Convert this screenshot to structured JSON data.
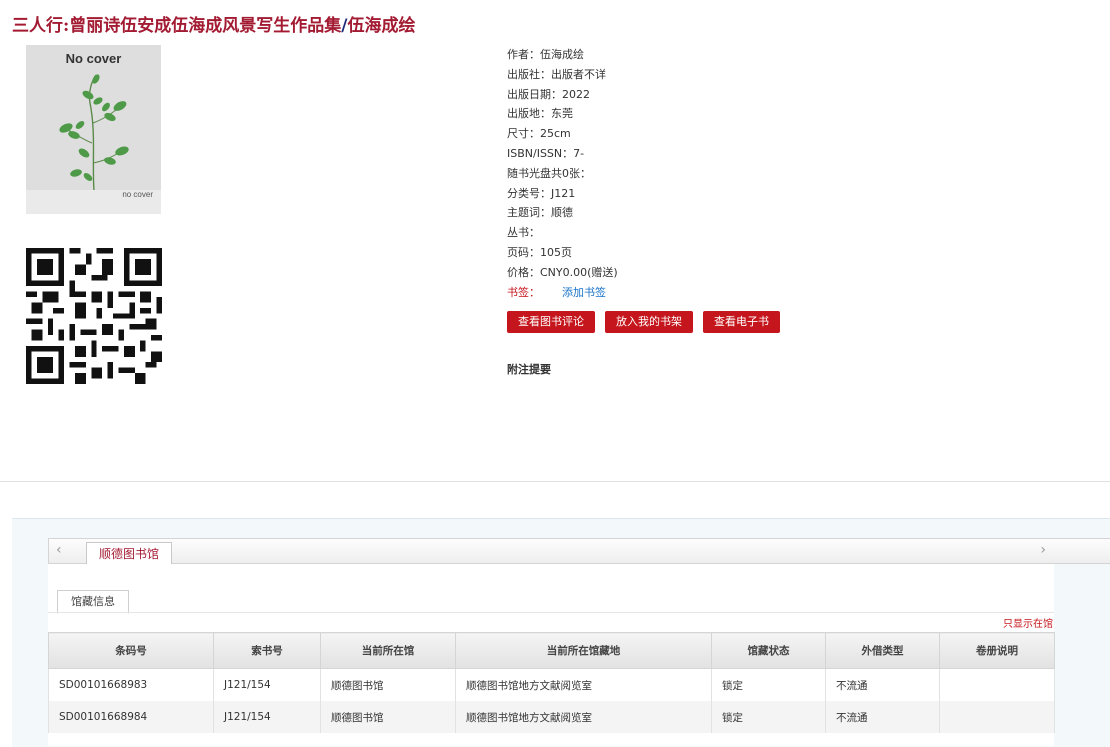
{
  "book": {
    "title_main": "三人行:曾丽诗伍安成伍海成风景写生作品集",
    "title_sep": "/",
    "title_author": "伍海成绘",
    "cover_top_text": "No cover",
    "cover_bottom_text": "no cover"
  },
  "meta": [
    "作者：伍海成绘",
    "出版社：出版者不详",
    "出版日期：2022",
    "出版地：东莞",
    "尺寸：25cm",
    "ISBN/ISSN：7-",
    "随书光盘共0张：",
    "分类号：J121",
    "主题词：顺德",
    "丛书：",
    "页码：105页",
    "价格：CNY0.00(赠送)"
  ],
  "bookmark": {
    "label": "书签：",
    "link": "添加书签"
  },
  "buttons": {
    "reviews": "查看图书评论",
    "shelf": "放入我的书架",
    "ebook": "查看电子书"
  },
  "notes_title": "附注提要",
  "holdings": {
    "nav_prev": "‹",
    "nav_next": "›",
    "library_tab": "顺德图书馆",
    "sub_tab": "馆藏信息",
    "only_local": "只显示在馆",
    "columns": [
      "条码号",
      "索书号",
      "当前所在馆",
      "当前所在馆藏地",
      "馆藏状态",
      "外借类型",
      "卷册说明"
    ],
    "rows": [
      [
        "SD00101668983",
        "J121/154",
        "顺德图书馆",
        "顺德图书馆地方文献阅览室",
        "锁定",
        "不流通",
        ""
      ],
      [
        "SD00101668984",
        "J121/154",
        "顺德图书馆",
        "顺德图书馆地方文献阅览室",
        "锁定",
        "不流通",
        ""
      ]
    ]
  }
}
